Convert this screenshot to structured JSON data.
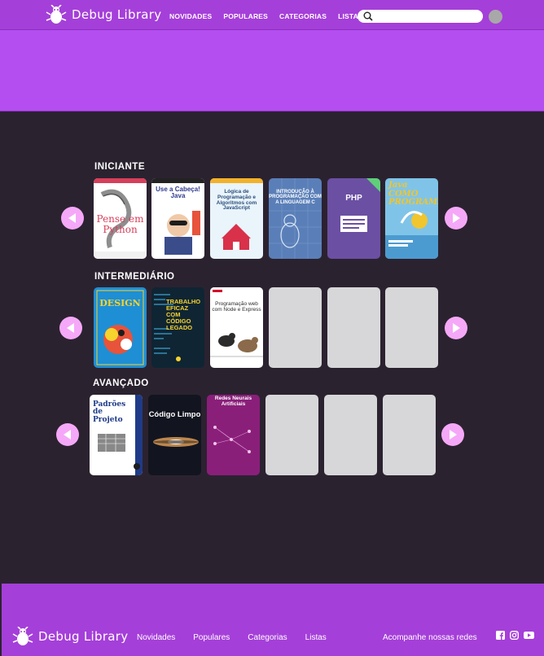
{
  "app": {
    "brand": "Debug Library"
  },
  "header": {
    "nav": [
      "NOVIDADES",
      "POPULARES",
      "CATEGORIAS",
      "LISTAS"
    ],
    "search": {
      "value": "",
      "placeholder": ""
    }
  },
  "sections": [
    {
      "title": "INICIANTE",
      "books": [
        {
          "title": "Pense em Python",
          "cover_color": "#ffffff",
          "accent": "#d63f5a"
        },
        {
          "title": "Use a Cabeça! Java",
          "cover_color": "#ffffff",
          "accent": "#2f3a8f"
        },
        {
          "title": "Lógica de Programação e Algoritmos com JavaScript",
          "cover_color": "#e9f4fb",
          "accent": "#d9314a"
        },
        {
          "title": "INTRODUÇÃO À PROGRAMAÇÃO COM A LINGUAGEM C",
          "cover_color": "#5a7fb8",
          "accent": "#d7e3f5"
        },
        {
          "title": "PHP",
          "cover_color": "#6b4fa3",
          "accent": "#ffffff"
        },
        {
          "title": "Java COMO PROGRAMAR",
          "cover_color": "#7fc4e8",
          "accent": "#f1c52d"
        }
      ]
    },
    {
      "title": "INTERMEDIÁRIO",
      "books": [
        {
          "title": "DESIGN",
          "cover_color": "#1e8fd4",
          "accent": "#f6d32d"
        },
        {
          "title": "TRABALHO EFICAZ COM CÓDIGO LEGADO",
          "cover_color": "#0f2533",
          "accent": "#f6d32d"
        },
        {
          "title": "Programação web com Node e Express",
          "cover_color": "#ffffff",
          "accent": "#2b2b2b"
        },
        {
          "title": "",
          "cover_color": ""
        },
        {
          "title": "",
          "cover_color": ""
        },
        {
          "title": "",
          "cover_color": ""
        }
      ]
    },
    {
      "title": "AVANÇADO",
      "books": [
        {
          "title": "Padrões de Projeto",
          "cover_color": "#ffffff",
          "accent": "#1f3b88"
        },
        {
          "title": "Código Limpo",
          "cover_color": "#12151f",
          "accent": "#ffffff"
        },
        {
          "title": "Redes Neurais Artificiais",
          "cover_color": "#8a1f7a",
          "accent": "#ffffff"
        },
        {
          "title": "",
          "cover_color": ""
        },
        {
          "title": "",
          "cover_color": ""
        },
        {
          "title": "",
          "cover_color": ""
        }
      ]
    }
  ],
  "footer": {
    "nav": [
      "Novidades",
      "Populares",
      "Categorias",
      "Listas"
    ],
    "social_label": "Acompanhe nossas redes",
    "socials": [
      "facebook-icon",
      "instagram-icon",
      "youtube-icon"
    ]
  },
  "colors": {
    "primary": "#a53fd9",
    "banner": "#b44ef0",
    "background": "#2b2230",
    "arrow": "#f5a8f7",
    "placeholder": "#d7d7d9"
  }
}
